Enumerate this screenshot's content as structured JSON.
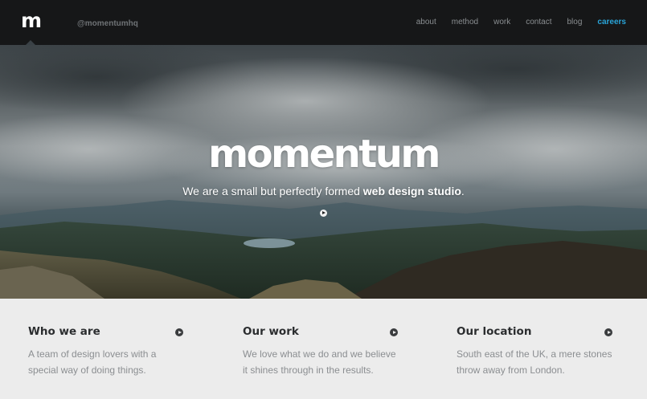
{
  "header": {
    "logo": "m",
    "handle": "@momentumhq",
    "nav": [
      {
        "label": "about"
      },
      {
        "label": "method"
      },
      {
        "label": "work"
      },
      {
        "label": "contact"
      },
      {
        "label": "blog"
      },
      {
        "label": "careers",
        "active": true
      }
    ],
    "accent_color": "#29a4d8"
  },
  "hero": {
    "title": "momentum",
    "tagline_prefix": "We are a small but perfectly formed ",
    "tagline_bold": "web design studio",
    "tagline_suffix": ".",
    "play_icon": "play-icon"
  },
  "columns": [
    {
      "title": "Who we are",
      "text": "A team of design lovers with a special way of doing things.",
      "icon": "arrow-right-icon"
    },
    {
      "title": "Our work",
      "text": "We love what we do and we believe it shines through in the results.",
      "icon": "arrow-right-icon"
    },
    {
      "title": "Our location",
      "text": "South east of the UK, a mere stones throw away from London.",
      "icon": "arrow-right-icon"
    }
  ]
}
